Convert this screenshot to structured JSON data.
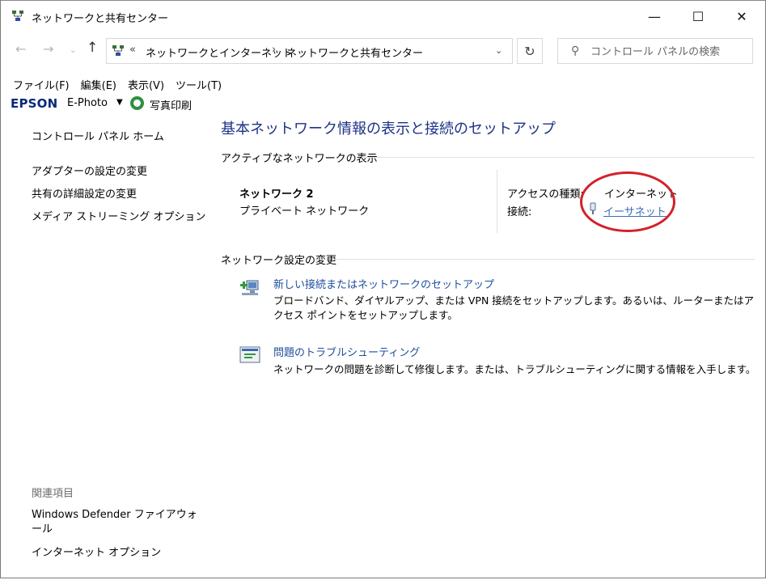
{
  "window": {
    "title": "ネットワークと共有センター",
    "controls": {
      "minimize": "—",
      "maximize": "☐",
      "close": "✕"
    }
  },
  "address": {
    "overflow": "«",
    "crumbs": [
      "ネットワークとインターネット",
      "ネットワークと共有センター"
    ],
    "separator": "›",
    "search_placeholder": "コントロール パネルの検索"
  },
  "menu": [
    "ファイル(F)",
    "編集(E)",
    "表示(V)",
    "ツール(T)"
  ],
  "epson": {
    "logo": "EPSON",
    "ephoto": "E-Photo",
    "print": "写真印刷"
  },
  "sidebar": {
    "home": "コントロール パネル ホーム",
    "links": [
      "アダプターの設定の変更",
      "共有の詳細設定の変更",
      "メディア ストリーミング オプション"
    ],
    "related_header": "関連項目",
    "related": [
      "Windows Defender ファイアウォール",
      "インターネット オプション"
    ]
  },
  "main": {
    "title": "基本ネットワーク情報の表示と接続のセットアップ",
    "active_header": "アクティブなネットワークの表示",
    "network": {
      "name": "ネットワーク 2",
      "type": "プライベート ネットワーク",
      "access_label": "アクセスの種類:",
      "access_value": "インターネット",
      "connection_label": "接続:",
      "connection_value": "イーサネット"
    },
    "change_header": "ネットワーク設定の変更",
    "tasks": [
      {
        "link": "新しい接続またはネットワークのセットアップ",
        "desc": "ブロードバンド、ダイヤルアップ、または VPN 接続をセットアップします。あるいは、ルーターまたはアクセス ポイントをセットアップします。"
      },
      {
        "link": "問題のトラブルシューティング",
        "desc": "ネットワークの問題を診断して修復します。または、トラブルシューティングに関する情報を入手します。"
      }
    ]
  },
  "colors": {
    "title_blue": "#1e3287",
    "link_blue": "#1e4e9b",
    "highlight_red": "#d4202a",
    "epson_blue": "#0a2a78"
  }
}
